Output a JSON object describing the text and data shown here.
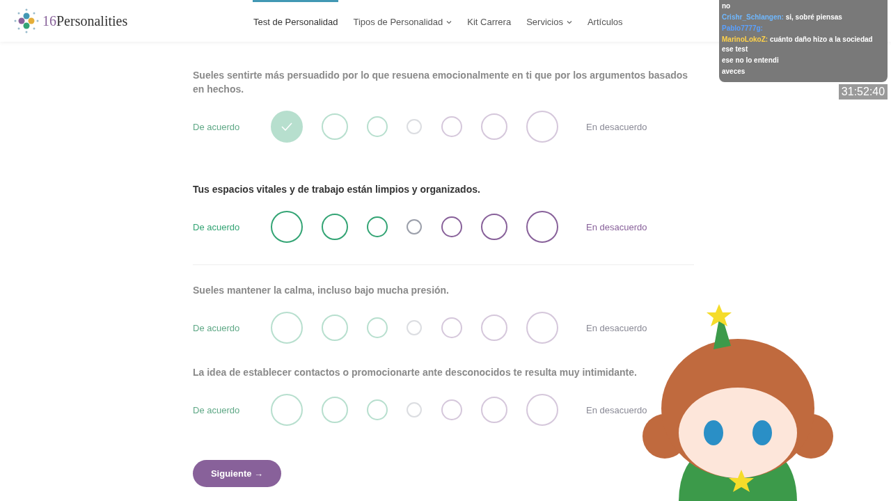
{
  "logo": {
    "number": "16",
    "name": "Personalities"
  },
  "nav": [
    {
      "label": "Test de Personalidad",
      "selected": true,
      "dropdown": false
    },
    {
      "label": "Tipos de Personalidad",
      "selected": false,
      "dropdown": true
    },
    {
      "label": "Kit Carrera",
      "selected": false,
      "dropdown": false
    },
    {
      "label": "Servicios",
      "selected": false,
      "dropdown": true
    },
    {
      "label": "Artículos",
      "selected": false,
      "dropdown": false
    }
  ],
  "questions": [
    {
      "text": "Sueles sentirte más persuadido por lo que resuena emocionalmente en ti que por los argumentos basados en hechos.",
      "active": false,
      "agree": "De acuerdo",
      "disagree": "En desacuerdo",
      "options": [
        {
          "selected": true
        },
        {
          "selected": false
        },
        {
          "selected": false
        },
        {
          "selected": false
        },
        {
          "selected": false
        },
        {
          "selected": false
        },
        {
          "selected": false
        }
      ]
    },
    {
      "text": "Tus espacios vitales y de trabajo están limpios y organizados.",
      "active": true,
      "agree": "De acuerdo",
      "disagree": "En desacuerdo",
      "options": [
        {
          "selected": false
        },
        {
          "selected": false
        },
        {
          "selected": false
        },
        {
          "selected": false
        },
        {
          "selected": false
        },
        {
          "selected": false
        },
        {
          "selected": false
        }
      ]
    },
    {
      "text": "Sueles mantener la calma, incluso bajo mucha presión.",
      "active": false,
      "agree": "De acuerdo",
      "disagree": "En desacuerdo",
      "options": [
        {
          "selected": false
        },
        {
          "selected": false
        },
        {
          "selected": false
        },
        {
          "selected": false
        },
        {
          "selected": false
        },
        {
          "selected": false
        },
        {
          "selected": false
        }
      ]
    },
    {
      "text": "La idea de establecer contactos o promocionarte ante desconocidos te resulta muy intimidante.",
      "active": false,
      "agree": "De acuerdo",
      "disagree": "En desacuerdo",
      "options": [
        {
          "selected": false
        },
        {
          "selected": false
        },
        {
          "selected": false
        },
        {
          "selected": false
        },
        {
          "selected": false
        },
        {
          "selected": false
        },
        {
          "selected": false
        }
      ]
    }
  ],
  "next_button": {
    "label": "Siguiente",
    "arrow": "→"
  },
  "chat": [
    {
      "text": "no"
    },
    {
      "user": "Crishr_Schlangen:",
      "color": "#6fb8ff",
      "text": "si, sobré piensas"
    },
    {
      "user": "Pablo7777g:",
      "color": "#5aa0ff"
    },
    {
      "user": "MarinoLokoZ:",
      "color": "#ffd24a",
      "text": "cuánto daño hizo a la sociedad ese test"
    },
    {
      "text": "ese no lo entendi"
    },
    {
      "text": "aveces"
    }
  ],
  "timer": "31:52:40"
}
